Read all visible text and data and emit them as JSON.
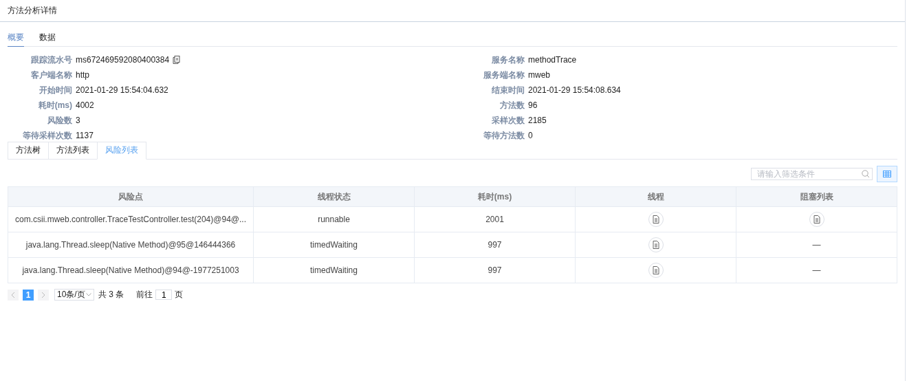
{
  "window": {
    "title": "方法分析详情"
  },
  "tabs": [
    {
      "label": "概要",
      "selected": true
    },
    {
      "label": "数据",
      "selected": false
    }
  ],
  "summary": {
    "left": [
      {
        "label": "跟踪流水号",
        "value": "ms672469592080400384",
        "copyable": true
      },
      {
        "label": "客户端名称",
        "value": "http",
        "copyable": false
      },
      {
        "label": "开始时间",
        "value": "2021-01-29 15:54:04.632",
        "copyable": false
      },
      {
        "label": "耗时(ms)",
        "value": "4002",
        "copyable": false
      },
      {
        "label": "风险数",
        "value": "3",
        "copyable": false
      },
      {
        "label": "等待采样次数",
        "value": "1137",
        "copyable": false
      }
    ],
    "right": [
      {
        "label": "服务名称",
        "value": "methodTrace",
        "copyable": false
      },
      {
        "label": "服务端名称",
        "value": "mweb",
        "copyable": false
      },
      {
        "label": "结束时间",
        "value": "2021-01-29 15:54:08.634",
        "copyable": false
      },
      {
        "label": "方法数",
        "value": "96",
        "copyable": false
      },
      {
        "label": "采样次数",
        "value": "2185",
        "copyable": false
      },
      {
        "label": "等待方法数",
        "value": "0",
        "copyable": false
      }
    ]
  },
  "sub_tabs": [
    {
      "label": "方法树",
      "selected": false
    },
    {
      "label": "方法列表",
      "selected": false
    },
    {
      "label": "风险列表",
      "selected": true
    }
  ],
  "filter": {
    "placeholder": "请输入筛选条件"
  },
  "table": {
    "columns": [
      "风险点",
      "线程状态",
      "耗时(ms)",
      "线程",
      "阻塞列表"
    ],
    "rows": [
      {
        "risk_point": "com.csii.mweb.controller.TraceTestController.test(204)@94@...",
        "thread_state": "runnable",
        "time_ms": "2001",
        "thread": {
          "kind": "button"
        },
        "blocked_list": {
          "kind": "button"
        }
      },
      {
        "risk_point": "java.lang.Thread.sleep(Native Method)@95@146444366",
        "thread_state": "timedWaiting",
        "time_ms": "997",
        "thread": {
          "kind": "button"
        },
        "blocked_list": {
          "kind": "text",
          "text": "—"
        }
      },
      {
        "risk_point": "java.lang.Thread.sleep(Native Method)@94@-1977251003",
        "thread_state": "timedWaiting",
        "time_ms": "997",
        "thread": {
          "kind": "button"
        },
        "blocked_list": {
          "kind": "text",
          "text": "—"
        }
      }
    ]
  },
  "pagination": {
    "pages": [
      {
        "label": "1",
        "selected": true
      }
    ],
    "page_size": "10条/页",
    "total": "共 3 条",
    "goto_label": "前往",
    "goto_value": "1",
    "page_unit": "页"
  }
}
